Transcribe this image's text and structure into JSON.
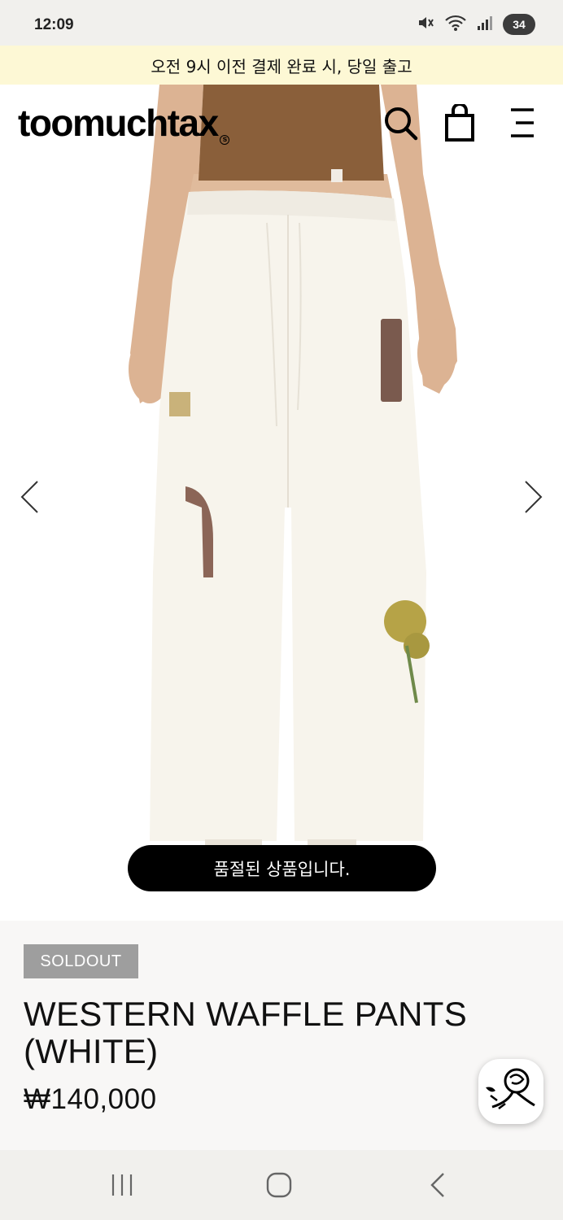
{
  "status_bar": {
    "time": "12:09",
    "battery": "34",
    "icons": [
      "mute-icon",
      "wifi-icon",
      "signal-icon"
    ]
  },
  "promo_banner": {
    "text": "오전 9시 이전 결제 완료 시, 당일 출고"
  },
  "header": {
    "logo": "toomuchtax",
    "logo_mark": "s",
    "icons": [
      "search-icon",
      "shopping-bag-icon",
      "menu-icon"
    ]
  },
  "carousel": {
    "prev_icon": "chevron-left-icon",
    "next_icon": "chevron-right-icon"
  },
  "toast": {
    "text": "품절된 상품입니다."
  },
  "product": {
    "badge": "SOLDOUT",
    "name": "WESTERN WAFFLE PANTS (WHITE)",
    "price": "₩140,000"
  },
  "colors": {
    "promo_bg": "#fdf8d5",
    "toast_bg": "#000000",
    "badge_bg": "#9e9e9e",
    "info_bg": "#f8f7f6"
  },
  "nav_bar": {
    "icons": [
      "recent-apps-icon",
      "home-icon",
      "back-icon"
    ]
  }
}
